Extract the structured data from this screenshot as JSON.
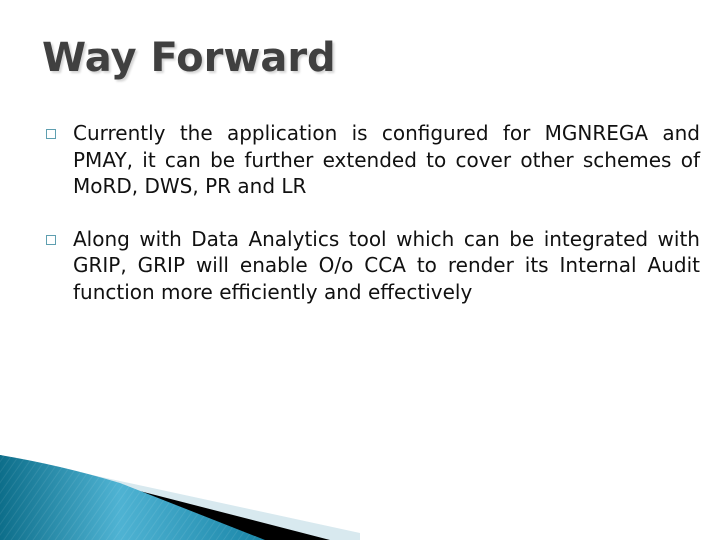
{
  "slide": {
    "title": "Way Forward",
    "bullets": [
      {
        "icon": "hollow-square-bullet",
        "text": "Currently the application is configured for MGNREGA and PMAY, it can be further extended to cover other schemes of MoRD, DWS, PR and LR"
      },
      {
        "icon": "hollow-square-bullet",
        "text": "Along with Data Analytics tool which can be integrated with GRIP, GRIP will enable O/o CCA to render its Internal Audit function more efficiently and effectively"
      }
    ],
    "colors": {
      "title": "#404040",
      "body_text": "#111111",
      "bullet_outline": "#5f9fb0",
      "wave_teal_dark": "#0d6e8a",
      "wave_teal_light": "#4fb3d3",
      "wave_black": "#000000",
      "wave_pale": "#d8e9ef"
    }
  }
}
